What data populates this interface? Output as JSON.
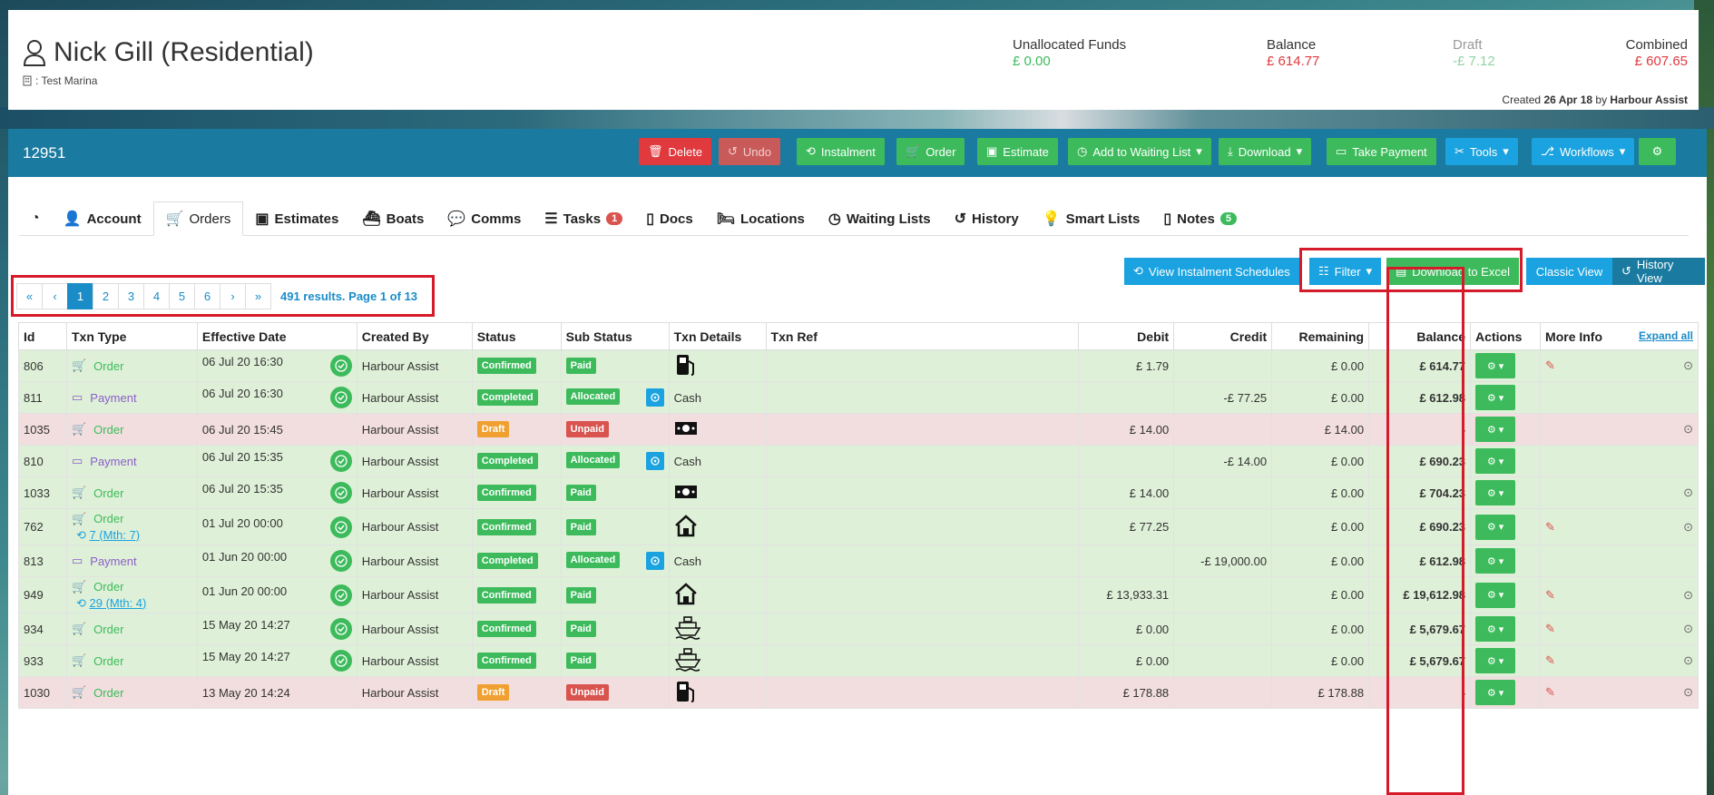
{
  "header": {
    "name": "Nick Gill (Residential)",
    "marina": ": Test Marina",
    "stats": [
      {
        "label": "Unallocated Funds",
        "value": "£ 0.00",
        "color": "#3dbb5c"
      },
      {
        "label": "Balance",
        "value": "£ 614.77",
        "color": "#e0393e"
      },
      {
        "label": "Draft",
        "value": "-£ 7.12",
        "color": "#8fd4a4"
      },
      {
        "label": "Combined",
        "value": "£ 607.65",
        "color": "#e0393e"
      }
    ],
    "created_prefix": "Created",
    "created_date": "26 Apr 18",
    "created_by_prefix": "by",
    "created_by": "Harbour Assist"
  },
  "toolbar": {
    "account_id": "12951",
    "buttons": {
      "delete": "Delete",
      "undo": "Undo",
      "instalment": "Instalment",
      "order": "Order",
      "estimate": "Estimate",
      "waiting": "Add to Waiting List",
      "download": "Download",
      "payment": "Take Payment",
      "tools": "Tools",
      "workflows": "Workflows"
    }
  },
  "tabs": [
    "Account",
    "Orders",
    "Estimates",
    "Boats",
    "Comms",
    "Tasks",
    "Docs",
    "Locations",
    "Waiting Lists",
    "History",
    "Smart Lists",
    "Notes"
  ],
  "tab_badges": {
    "tasks": "1",
    "notes": "5"
  },
  "actions": {
    "instalment_schedules": "View Instalment Schedules",
    "filter": "Filter",
    "excel": "Download to Excel",
    "classic": "Classic View",
    "history": "History View"
  },
  "pager": {
    "first": "«",
    "prev": "‹",
    "pages": [
      "1",
      "2",
      "3",
      "4",
      "5",
      "6"
    ],
    "next": "›",
    "last": "»",
    "info": "491 results. Page 1 of 13"
  },
  "table": {
    "headers": [
      "Id",
      "Txn Type",
      "Effective Date",
      "Created By",
      "Status",
      "Sub Status",
      "Txn Details",
      "Txn Ref",
      "Debit",
      "Credit",
      "Remaining",
      "Balance",
      "Actions",
      "More Info"
    ],
    "expand_all": "Expand all",
    "rows": [
      {
        "id": "806",
        "type": "Order",
        "date": "06 Jul 20 16:30",
        "by": "Harbour Assist",
        "status": "Confirmed",
        "sub": "Paid",
        "details": "fuel-icon",
        "debit": "£ 1.79",
        "credit": "",
        "remaining": "£ 0.00",
        "balance": "£ 614.77",
        "tone": "g"
      },
      {
        "id": "811",
        "type": "Payment",
        "date": "06 Jul 20 16:30",
        "by": "Harbour Assist",
        "status": "Completed",
        "sub": "Allocated",
        "details": "Cash",
        "debit": "",
        "credit": "-£ 77.25",
        "remaining": "£ 0.00",
        "balance": "£ 612.98",
        "tone": "g"
      },
      {
        "id": "1035",
        "type": "Order",
        "date": "06 Jul 20 15:45",
        "by": "Harbour Assist",
        "status": "Draft",
        "sub": "Unpaid",
        "details": "cash-icon",
        "debit": "£ 14.00",
        "credit": "",
        "remaining": "£ 14.00",
        "balance": "-",
        "tone": "p"
      },
      {
        "id": "810",
        "type": "Payment",
        "date": "06 Jul 20 15:35",
        "by": "Harbour Assist",
        "status": "Completed",
        "sub": "Allocated",
        "details": "Cash",
        "debit": "",
        "credit": "-£ 14.00",
        "remaining": "£ 0.00",
        "balance": "£ 690.23",
        "tone": "g"
      },
      {
        "id": "1033",
        "type": "Order",
        "date": "06 Jul 20 15:35",
        "by": "Harbour Assist",
        "status": "Confirmed",
        "sub": "Paid",
        "details": "cash-icon",
        "debit": "£ 14.00",
        "credit": "",
        "remaining": "£ 0.00",
        "balance": "£ 704.23",
        "tone": "g"
      },
      {
        "id": "762",
        "type": "Order",
        "instalment": "7 (Mth: 7)",
        "date": "01 Jul 20 00:00",
        "by": "Harbour Assist",
        "status": "Confirmed",
        "sub": "Paid",
        "details": "house-icon",
        "debit": "£ 77.25",
        "credit": "",
        "remaining": "£ 0.00",
        "balance": "£ 690.23",
        "tone": "g"
      },
      {
        "id": "813",
        "type": "Payment",
        "date": "01 Jun 20 00:00",
        "by": "Harbour Assist",
        "status": "Completed",
        "sub": "Allocated",
        "details": "Cash",
        "debit": "",
        "credit": "-£ 19,000.00",
        "remaining": "£ 0.00",
        "balance": "£ 612.98",
        "tone": "g"
      },
      {
        "id": "949",
        "type": "Order",
        "instalment": "29 (Mth: 4)",
        "date": "01 Jun 20 00:00",
        "by": "Harbour Assist",
        "status": "Confirmed",
        "sub": "Paid",
        "details": "house-icon",
        "debit": "£ 13,933.31",
        "credit": "",
        "remaining": "£ 0.00",
        "balance": "£ 19,612.98",
        "tone": "g"
      },
      {
        "id": "934",
        "type": "Order",
        "date": "15 May 20 14:27",
        "by": "Harbour Assist",
        "status": "Confirmed",
        "sub": "Paid",
        "details": "boat-icon",
        "debit": "£ 0.00",
        "credit": "",
        "remaining": "£ 0.00",
        "balance": "£ 5,679.67",
        "tone": "g"
      },
      {
        "id": "933",
        "type": "Order",
        "date": "15 May 20 14:27",
        "by": "Harbour Assist",
        "status": "Confirmed",
        "sub": "Paid",
        "details": "boat-icon",
        "debit": "£ 0.00",
        "credit": "",
        "remaining": "£ 0.00",
        "balance": "£ 5,679.67",
        "tone": "g"
      },
      {
        "id": "1030",
        "type": "Order",
        "date": "13 May 20 14:24",
        "by": "Harbour Assist",
        "status": "Draft",
        "sub": "Unpaid",
        "details": "fuel-icon",
        "debit": "£ 178.88",
        "credit": "",
        "remaining": "£ 178.88",
        "balance": "-",
        "tone": "p"
      }
    ]
  }
}
